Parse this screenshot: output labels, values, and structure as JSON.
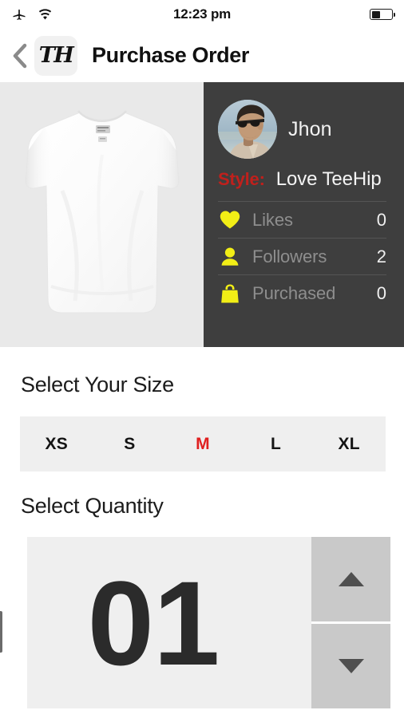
{
  "status_bar": {
    "airplane_icon": "airplane-mode-icon",
    "wifi_icon": "wifi-icon",
    "time": "12:23 pm",
    "battery_icon": "battery-icon",
    "battery_percent": 40
  },
  "nav": {
    "back_icon": "back-chevron-icon",
    "brand_logo": "TH",
    "title": "Purchase Order"
  },
  "hero": {
    "product": {
      "image_name": "white-tshirt-photo",
      "alt": "White crew neck t-shirt"
    },
    "profile": {
      "avatar_name": "user-avatar-photo",
      "name": "Jhon",
      "style_label": "Style:",
      "style_value": "Love TeeHip",
      "stats": [
        {
          "icon": "heart-icon",
          "label": "Likes",
          "value": "0"
        },
        {
          "icon": "person-icon",
          "label": "Followers",
          "value": "2"
        },
        {
          "icon": "shopping-bag-icon",
          "label": "Purchased",
          "value": "0"
        }
      ]
    }
  },
  "size_section": {
    "heading": "Select Your Size",
    "options": [
      {
        "label": "XS",
        "selected": false
      },
      {
        "label": "S",
        "selected": false
      },
      {
        "label": "M",
        "selected": true
      },
      {
        "label": "L",
        "selected": false
      },
      {
        "label": "XL",
        "selected": false
      }
    ],
    "selected": "M"
  },
  "quantity_section": {
    "heading": "Select Quantity",
    "value": "01",
    "increment_icon": "triangle-up-icon",
    "decrement_icon": "triangle-down-icon"
  },
  "colors": {
    "accent_red": "#e01f1f",
    "style_red": "#c0201c",
    "icon_yellow": "#f2ee16",
    "panel_dark": "#3e3e3e",
    "field_gray": "#efefef",
    "stepper_gray": "#c9c9c9"
  }
}
